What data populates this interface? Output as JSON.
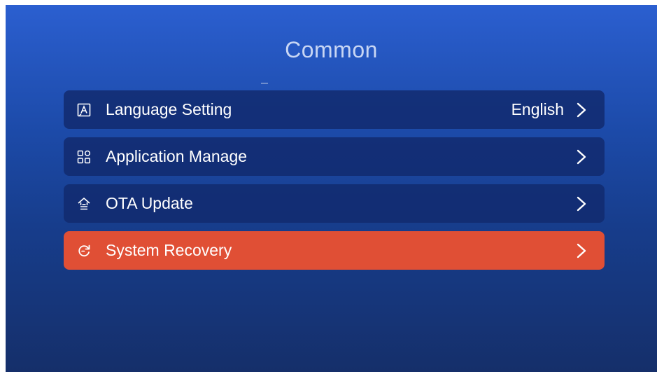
{
  "page": {
    "title": "Common"
  },
  "menu": {
    "items": [
      {
        "label": "Language Setting",
        "value": "English",
        "icon": "language-icon"
      },
      {
        "label": "Application Manage",
        "value": "",
        "icon": "apps-grid-icon"
      },
      {
        "label": "OTA Update",
        "value": "",
        "icon": "ota-update-icon"
      },
      {
        "label": "System Recovery",
        "value": "",
        "icon": "recovery-icon",
        "selected": true
      }
    ]
  },
  "colors": {
    "background_top": "#2b5fd0",
    "background_bottom": "#152f6a",
    "row_background": "#1a3275",
    "selected_row": "#e04f35",
    "text": "#ffffff",
    "title_text": "#c8d6f4"
  }
}
